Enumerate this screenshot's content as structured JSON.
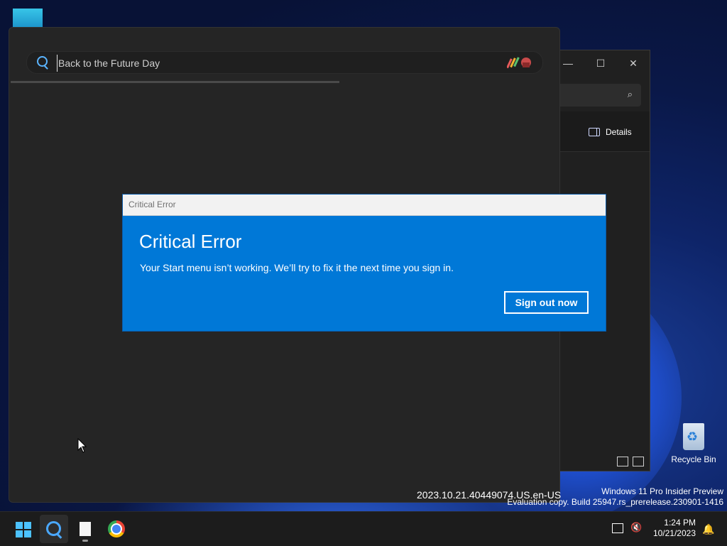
{
  "start_menu": {
    "search_value": "Back to the Future Day",
    "version_text": "2023.10.21.40449074.US.en-US"
  },
  "explorer": {
    "minimize": "—",
    "maximize": "☐",
    "close": "✕",
    "details_label": "Details"
  },
  "dialog": {
    "window_title": "Critical Error",
    "heading": "Critical Error",
    "message": "Your Start menu isn’t working. We’ll try to fix it the next time you sign in.",
    "button_label": "Sign out now"
  },
  "desktop": {
    "recycle_bin_label": "Recycle Bin",
    "watermark_line1": "Windows 11 Pro Insider Preview",
    "watermark_line2": "Evaluation copy. Build 25947.rs_prerelease.230901-1416"
  },
  "taskbar": {
    "time": "1:24 PM",
    "date": "10/21/2023",
    "icons": [
      "start-icon",
      "search-icon",
      "file-icon",
      "chrome-icon"
    ]
  },
  "colors": {
    "dialog_blue": "#0078d7",
    "accent": "#4cc2ff"
  }
}
